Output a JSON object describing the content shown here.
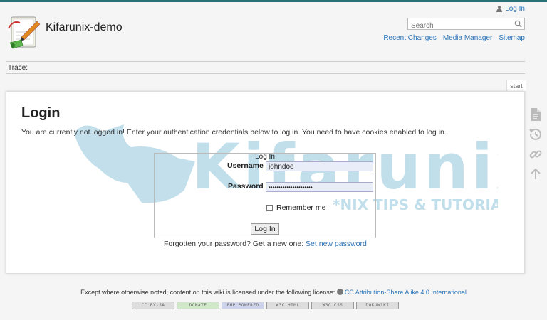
{
  "header": {
    "wiki_title": "Kifarunix-demo",
    "user_login": "Log In",
    "search_placeholder": "Search",
    "nav": [
      "Recent Changes",
      "Media Manager",
      "Sitemap"
    ]
  },
  "trace": {
    "label": "Trace:"
  },
  "page_tab": "start",
  "main": {
    "heading": "Login",
    "intro": "You are currently not logged in! Enter your authentication credentials below to log in. You need to have cookies enabled to log in.",
    "form": {
      "legend": "Log In",
      "username_label": "Username",
      "username_value": "johndoe",
      "password_label": "Password",
      "password_value": "••••••••••••••••••••••",
      "remember_label": "Remember me",
      "submit_label": "Log In"
    },
    "forgot_text": "Forgotten your password? Get a new one:",
    "forgot_link": "Set new password"
  },
  "watermark": {
    "brand": "Kifarunix",
    "tagline": "*NIX TIPS & TUTORIALS"
  },
  "footer": {
    "license_text": "Except where otherwise noted, content on this wiki is licensed under the following license:",
    "license_link": "CC Attribution-Share Alike 4.0 International",
    "badges": [
      "CC BY-SA",
      "DONATE",
      "PHP POWERED",
      "W3C HTML",
      "W3C CSS",
      "DOKUWIKI"
    ]
  },
  "colors": {
    "link": "#2b73b7",
    "accent": "#2b6e78",
    "watermark": "#4fa3c7"
  }
}
